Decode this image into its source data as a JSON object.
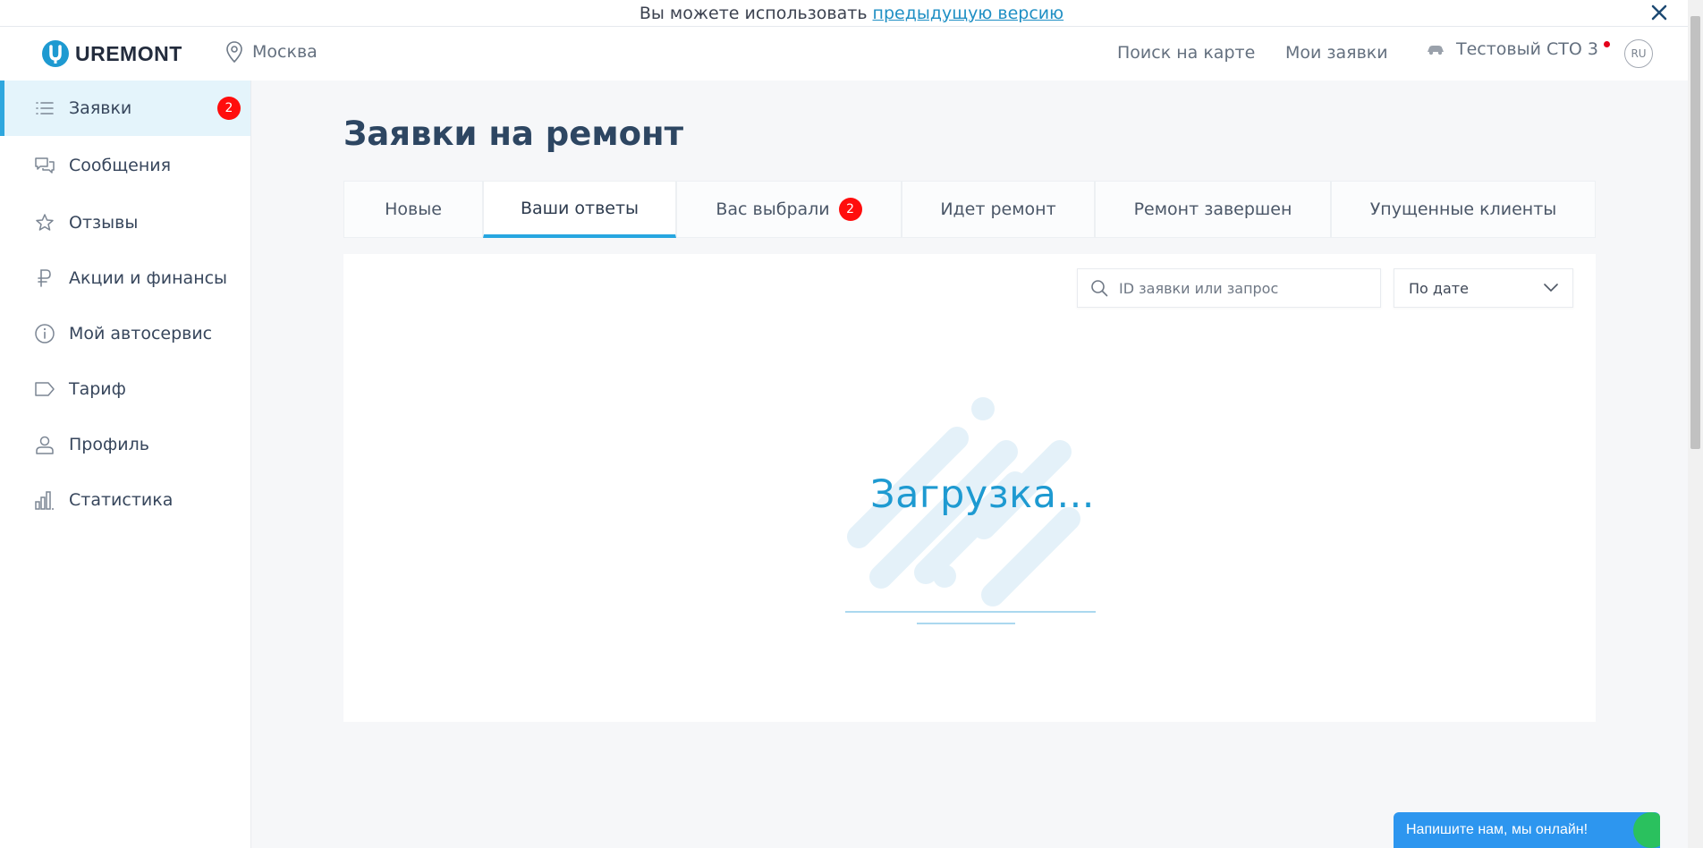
{
  "banner": {
    "text": "Вы можете использовать",
    "link": "предыдущую версию"
  },
  "header": {
    "logo_text": "UREMONT",
    "city": "Москва",
    "nav": {
      "map_search": "Поиск на карте",
      "my_requests": "Мои заявки"
    },
    "user_name": "Тестовый СТО 3",
    "lang": "RU"
  },
  "sidebar": {
    "items": [
      {
        "label": "Заявки",
        "icon": "list-icon",
        "badge": "2",
        "active": true
      },
      {
        "label": "Сообщения",
        "icon": "chat-icon"
      },
      {
        "label": "Отзывы",
        "icon": "star-icon"
      },
      {
        "label": "Акции и финансы",
        "icon": "ruble-icon"
      },
      {
        "label": "Мой автосервис",
        "icon": "info-icon"
      },
      {
        "label": "Тариф",
        "icon": "tag-icon"
      },
      {
        "label": "Профиль",
        "icon": "user-icon"
      },
      {
        "label": "Статистика",
        "icon": "bar-chart-icon"
      }
    ]
  },
  "main": {
    "title": "Заявки на ремонт",
    "tabs": [
      {
        "label": "Новые"
      },
      {
        "label": "Ваши ответы",
        "active": true
      },
      {
        "label": "Вас выбрали",
        "badge": "2"
      },
      {
        "label": "Идет ремонт"
      },
      {
        "label": "Ремонт завершен"
      },
      {
        "label": "Упущенные клиенты"
      }
    ],
    "search": {
      "placeholder": "ID заявки или запрос"
    },
    "sort": {
      "selected": "По дате"
    },
    "loading_text": "Загрузка..."
  },
  "chat": {
    "label": "Напишите нам, мы онлайн!"
  },
  "colors": {
    "accent": "#26a6e0",
    "badge": "#ff0d0d",
    "title": "#2d4662",
    "chat": "#2d96ef"
  }
}
